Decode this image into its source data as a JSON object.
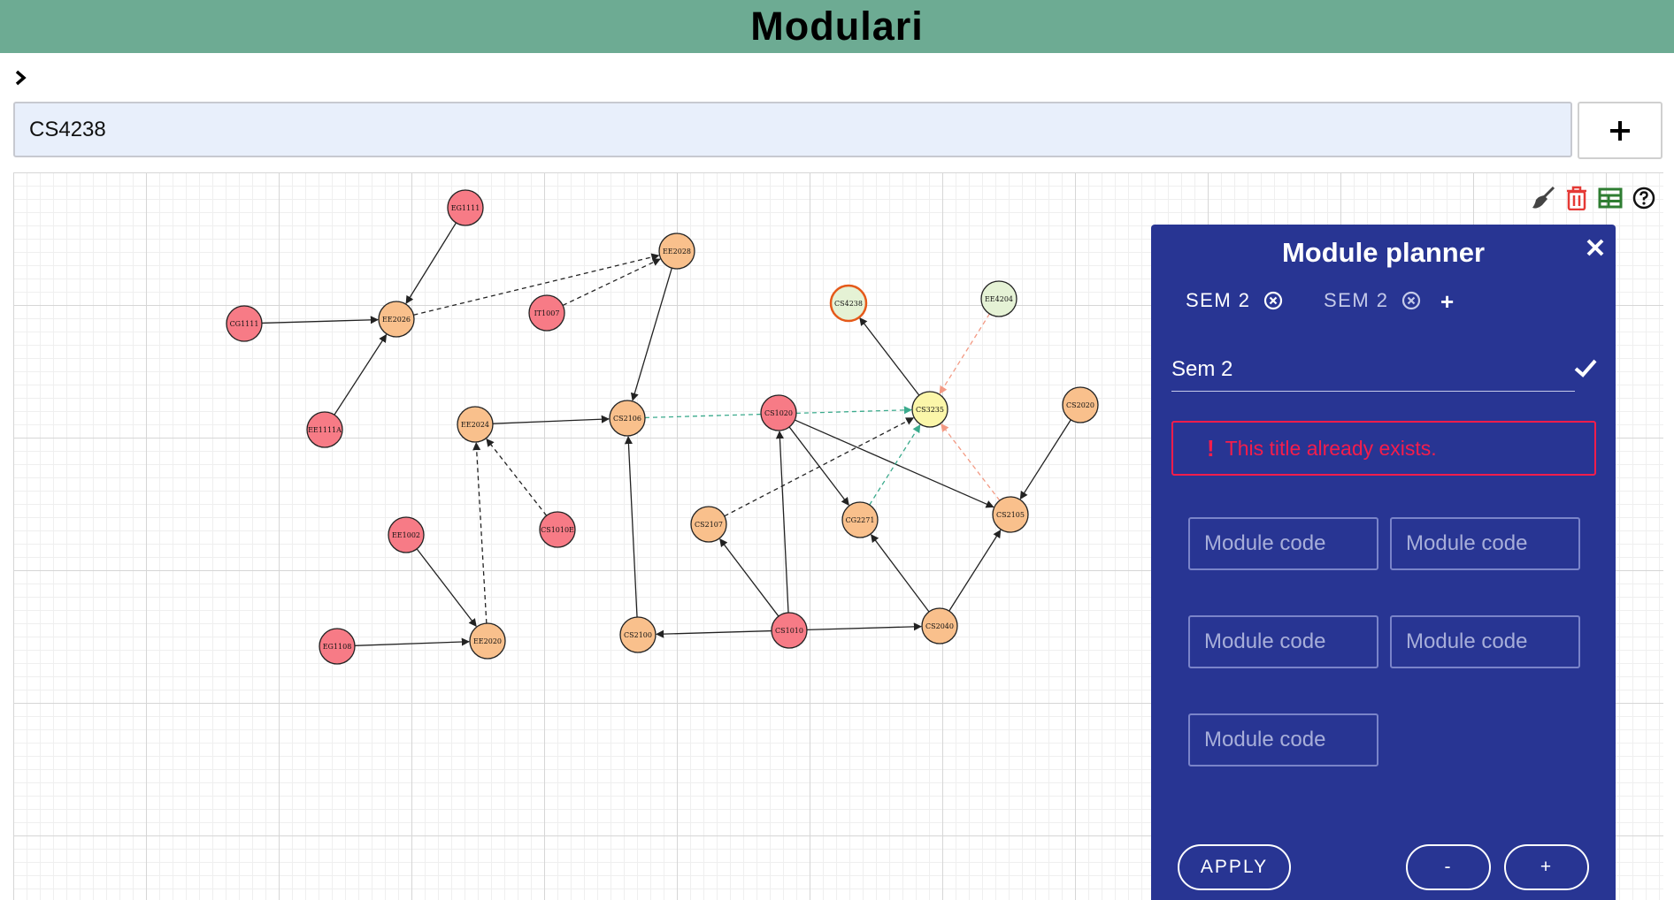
{
  "app": {
    "title": "Modulari"
  },
  "search": {
    "value": "CS4238",
    "add_label": "+"
  },
  "graph": {
    "nodes": [
      {
        "id": "EG1111",
        "color": "#f77b86"
      },
      {
        "id": "EE2028",
        "color": "#f9c08c"
      },
      {
        "id": "CG1111",
        "color": "#f77b86"
      },
      {
        "id": "EE2026",
        "color": "#f9c08c"
      },
      {
        "id": "IT1007",
        "color": "#f77b86"
      },
      {
        "id": "CS4238",
        "color": "#e5f2d5",
        "border": "#e55a1a"
      },
      {
        "id": "EE4204",
        "color": "#e5f2d5"
      },
      {
        "id": "EE1111A",
        "color": "#f77b86"
      },
      {
        "id": "EE2024",
        "color": "#f9c08c"
      },
      {
        "id": "CS2106",
        "color": "#f9c08c"
      },
      {
        "id": "CS1020",
        "color": "#f77b86"
      },
      {
        "id": "CS3235",
        "color": "#fbf6a9"
      },
      {
        "id": "CS2020",
        "color": "#f9c08c"
      },
      {
        "id": "EE1002",
        "color": "#f77b86"
      },
      {
        "id": "CS1010E",
        "color": "#f77b86"
      },
      {
        "id": "CS2107",
        "color": "#f9c08c"
      },
      {
        "id": "CG2271",
        "color": "#f9c08c"
      },
      {
        "id": "CS2105",
        "color": "#f9c08c"
      },
      {
        "id": "EG1108",
        "color": "#f77b86"
      },
      {
        "id": "EE2020",
        "color": "#f9c08c"
      },
      {
        "id": "CS2100",
        "color": "#f9c08c"
      },
      {
        "id": "CS1010",
        "color": "#f77b86"
      },
      {
        "id": "CS2040",
        "color": "#f9c08c"
      }
    ],
    "edges": [
      {
        "from": "EG1111",
        "to": "EE2026",
        "style": "solid",
        "color": "#222222"
      },
      {
        "from": "CG1111",
        "to": "EE2026",
        "style": "solid",
        "color": "#222222"
      },
      {
        "from": "EE1111A",
        "to": "EE2026",
        "style": "solid",
        "color": "#222222"
      },
      {
        "from": "EE2026",
        "to": "EE2028",
        "style": "dashed",
        "color": "#222222"
      },
      {
        "from": "IT1007",
        "to": "EE2028",
        "style": "dashed",
        "color": "#222222"
      },
      {
        "from": "EE2028",
        "to": "CS2106",
        "style": "solid",
        "color": "#222222"
      },
      {
        "from": "EE2024",
        "to": "CS2106",
        "style": "solid",
        "color": "#222222"
      },
      {
        "from": "CS1010E",
        "to": "EE2024",
        "style": "dashed",
        "color": "#222222"
      },
      {
        "from": "EE2020",
        "to": "EE2024",
        "style": "dashed",
        "color": "#222222"
      },
      {
        "from": "EE1002",
        "to": "EE2020",
        "style": "solid",
        "color": "#222222"
      },
      {
        "from": "EG1108",
        "to": "EE2020",
        "style": "solid",
        "color": "#222222"
      },
      {
        "from": "CS2100",
        "to": "CS2106",
        "style": "solid",
        "color": "#222222"
      },
      {
        "from": "CS1010",
        "to": "CS2100",
        "style": "solid",
        "color": "#222222"
      },
      {
        "from": "CS1010",
        "to": "CS1020",
        "style": "solid",
        "color": "#222222"
      },
      {
        "from": "CS1010",
        "to": "CS2107",
        "style": "solid",
        "color": "#222222"
      },
      {
        "from": "CS1010",
        "to": "CS2040",
        "style": "solid",
        "color": "#222222"
      },
      {
        "from": "CS2040",
        "to": "CG2271",
        "style": "solid",
        "color": "#222222"
      },
      {
        "from": "CS2040",
        "to": "CS2105",
        "style": "solid",
        "color": "#222222"
      },
      {
        "from": "CS1020",
        "to": "CG2271",
        "style": "solid",
        "color": "#222222"
      },
      {
        "from": "CS1020",
        "to": "CS2105",
        "style": "solid",
        "color": "#222222"
      },
      {
        "from": "CS2020",
        "to": "CS2105",
        "style": "solid",
        "color": "#222222"
      },
      {
        "from": "CS2107",
        "to": "CS3235",
        "style": "dashed",
        "color": "#222222"
      },
      {
        "from": "CS2106",
        "to": "CS3235",
        "style": "dashed",
        "color": "#3aaa8c"
      },
      {
        "from": "CG2271",
        "to": "CS3235",
        "style": "dashed",
        "color": "#3aaa8c"
      },
      {
        "from": "CS2105",
        "to": "CS3235",
        "style": "dashed",
        "color": "#f39a84"
      },
      {
        "from": "EE4204",
        "to": "CS3235",
        "style": "dashed",
        "color": "#f39a84"
      },
      {
        "from": "CS3235",
        "to": "CS4238",
        "style": "solid",
        "color": "#222222"
      }
    ]
  },
  "toolbar": {
    "tools": [
      {
        "icon": "broom-icon",
        "color": "#444444"
      },
      {
        "icon": "trash-icon",
        "color": "#e53935"
      },
      {
        "icon": "table-icon",
        "color": "#2e7d32"
      },
      {
        "icon": "help-icon",
        "color": "#111111"
      }
    ]
  },
  "planner": {
    "title": "Module planner",
    "tabs": [
      {
        "label": "SEM 2",
        "active": true
      },
      {
        "label": "SEM 2",
        "active": false
      }
    ],
    "add_tab": "+",
    "title_value": "Sem 2",
    "error": "This title already exists.",
    "error_icon": "!",
    "module_placeholder": "Module code",
    "apply_label": "APPLY",
    "minus_label": "-",
    "plus_label": "+"
  },
  "colors": {
    "header": "#6dab93",
    "planner_bg": "#283593",
    "error": "#f51d4b",
    "prereq_missing": "#f77b86",
    "prereq_partial": "#f9c08c",
    "prereq_target": "#fbf6a9",
    "prereq_selected": "#e5f2d5"
  }
}
